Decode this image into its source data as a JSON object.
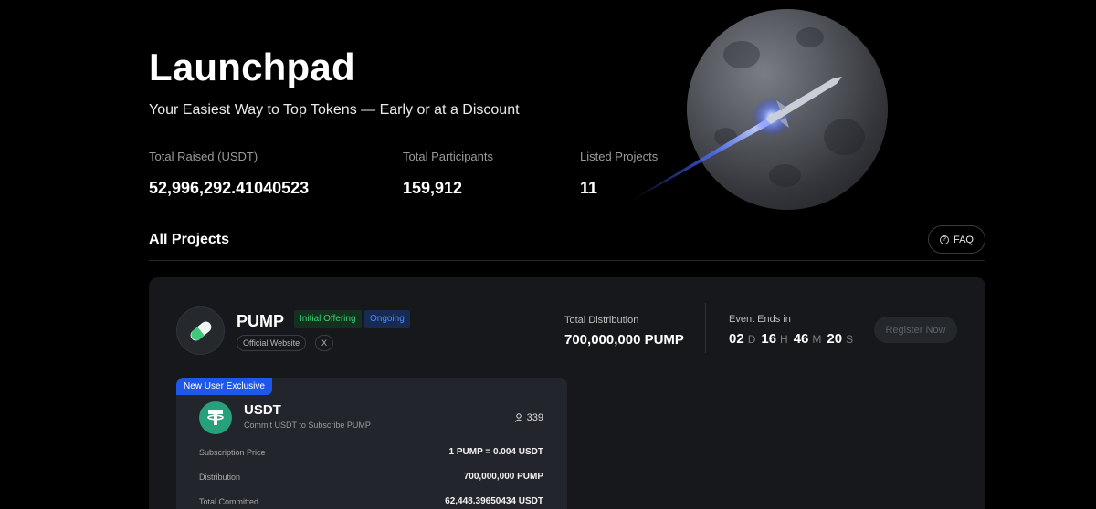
{
  "hero": {
    "title": "Launchpad",
    "subtitle": "Your Easiest Way to Top Tokens — Early or at a Discount"
  },
  "stats": [
    {
      "label": "Total Raised (USDT)",
      "value": "52,996,292.41040523"
    },
    {
      "label": "Total Participants",
      "value": "159,912"
    },
    {
      "label": "Listed Projects",
      "value": "11"
    }
  ],
  "section": {
    "title": "All Projects",
    "faq_label": "FAQ"
  },
  "project": {
    "name": "PUMP",
    "tags": [
      "Initial Offering",
      "Ongoing"
    ],
    "links": [
      "Official Website",
      "X"
    ],
    "distribution_label": "Total Distribution",
    "distribution_value": "700,000,000 PUMP",
    "ends_label": "Event Ends in",
    "countdown": {
      "days": "02",
      "days_unit": "D",
      "hours": "16",
      "hours_unit": "H",
      "minutes": "46",
      "minutes_unit": "M",
      "seconds": "20",
      "seconds_unit": "S"
    },
    "register_label": "Register Now"
  },
  "pool": {
    "badge": "New User Exclusive",
    "name": "USDT",
    "description": "Commit USDT to Subscribe PUMP",
    "participants": "339",
    "rows": [
      {
        "label": "Subscription Price",
        "value": "1 PUMP = 0.004 USDT"
      },
      {
        "label": "Distribution",
        "value": "700,000,000 PUMP"
      },
      {
        "label": "Total Committed",
        "value": "62,448.39650434 USDT"
      }
    ]
  },
  "colors": {
    "background": "#000000",
    "card": "#16181c",
    "pool_card": "#22252b",
    "tag_initial": "#3fcf75",
    "tag_ongoing": "#4a8cff",
    "badge_blue": "#1f58e8",
    "usdt_green": "#26a17b"
  },
  "icons": [
    "moon-rocket-illustration",
    "question-circle-icon",
    "pill-logo-icon",
    "tether-logo-icon",
    "user-icon"
  ]
}
